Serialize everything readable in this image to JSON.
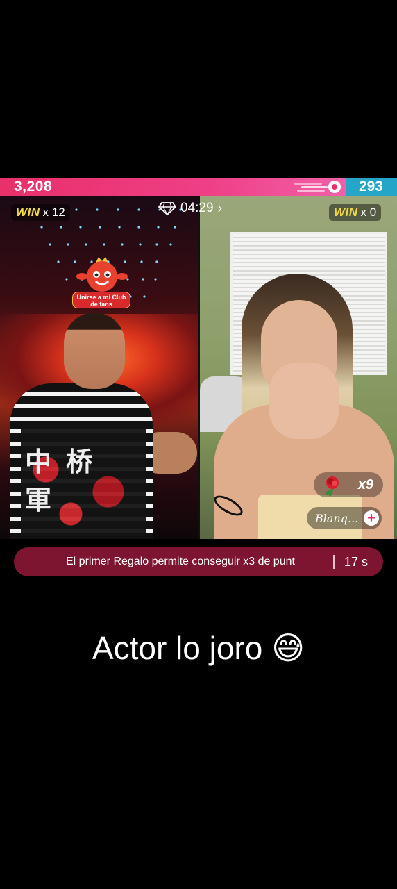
{
  "battle": {
    "left_score": "3,208",
    "right_score": "293",
    "timer": "04:29",
    "left_wins_label": "WIN",
    "left_wins_count": "x 12",
    "right_wins_label": "WIN",
    "right_wins_count": "x 0",
    "colors": {
      "left": "#e8306a",
      "right": "#25a6c9"
    }
  },
  "fan_club": {
    "label": "Unirse a mi Club de fans"
  },
  "gift": {
    "icon": "rose-icon",
    "count": "x9",
    "name": "Blanq..."
  },
  "banner": {
    "text": "El primer Regalo permite conseguir x3 de punt",
    "countdown": "17 s"
  },
  "shirt_text": "中 桥 軍",
  "caption": "Actor lo joro 😅"
}
